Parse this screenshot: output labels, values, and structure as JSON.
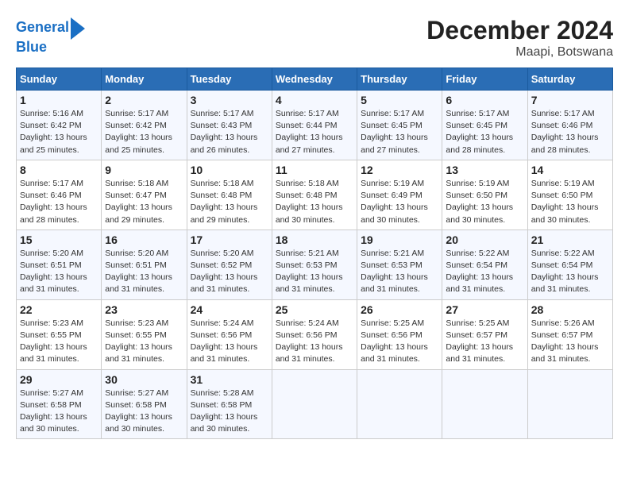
{
  "header": {
    "logo_line1": "General",
    "logo_line2": "Blue",
    "title": "December 2024",
    "subtitle": "Maapi, Botswana"
  },
  "columns": [
    "Sunday",
    "Monday",
    "Tuesday",
    "Wednesday",
    "Thursday",
    "Friday",
    "Saturday"
  ],
  "weeks": [
    [
      {
        "day": "1",
        "info": "Sunrise: 5:16 AM\nSunset: 6:42 PM\nDaylight: 13 hours\nand 25 minutes."
      },
      {
        "day": "2",
        "info": "Sunrise: 5:17 AM\nSunset: 6:42 PM\nDaylight: 13 hours\nand 25 minutes."
      },
      {
        "day": "3",
        "info": "Sunrise: 5:17 AM\nSunset: 6:43 PM\nDaylight: 13 hours\nand 26 minutes."
      },
      {
        "day": "4",
        "info": "Sunrise: 5:17 AM\nSunset: 6:44 PM\nDaylight: 13 hours\nand 27 minutes."
      },
      {
        "day": "5",
        "info": "Sunrise: 5:17 AM\nSunset: 6:45 PM\nDaylight: 13 hours\nand 27 minutes."
      },
      {
        "day": "6",
        "info": "Sunrise: 5:17 AM\nSunset: 6:45 PM\nDaylight: 13 hours\nand 28 minutes."
      },
      {
        "day": "7",
        "info": "Sunrise: 5:17 AM\nSunset: 6:46 PM\nDaylight: 13 hours\nand 28 minutes."
      }
    ],
    [
      {
        "day": "8",
        "info": "Sunrise: 5:17 AM\nSunset: 6:46 PM\nDaylight: 13 hours\nand 28 minutes."
      },
      {
        "day": "9",
        "info": "Sunrise: 5:18 AM\nSunset: 6:47 PM\nDaylight: 13 hours\nand 29 minutes."
      },
      {
        "day": "10",
        "info": "Sunrise: 5:18 AM\nSunset: 6:48 PM\nDaylight: 13 hours\nand 29 minutes."
      },
      {
        "day": "11",
        "info": "Sunrise: 5:18 AM\nSunset: 6:48 PM\nDaylight: 13 hours\nand 30 minutes."
      },
      {
        "day": "12",
        "info": "Sunrise: 5:19 AM\nSunset: 6:49 PM\nDaylight: 13 hours\nand 30 minutes."
      },
      {
        "day": "13",
        "info": "Sunrise: 5:19 AM\nSunset: 6:50 PM\nDaylight: 13 hours\nand 30 minutes."
      },
      {
        "day": "14",
        "info": "Sunrise: 5:19 AM\nSunset: 6:50 PM\nDaylight: 13 hours\nand 30 minutes."
      }
    ],
    [
      {
        "day": "15",
        "info": "Sunrise: 5:20 AM\nSunset: 6:51 PM\nDaylight: 13 hours\nand 31 minutes."
      },
      {
        "day": "16",
        "info": "Sunrise: 5:20 AM\nSunset: 6:51 PM\nDaylight: 13 hours\nand 31 minutes."
      },
      {
        "day": "17",
        "info": "Sunrise: 5:20 AM\nSunset: 6:52 PM\nDaylight: 13 hours\nand 31 minutes."
      },
      {
        "day": "18",
        "info": "Sunrise: 5:21 AM\nSunset: 6:53 PM\nDaylight: 13 hours\nand 31 minutes."
      },
      {
        "day": "19",
        "info": "Sunrise: 5:21 AM\nSunset: 6:53 PM\nDaylight: 13 hours\nand 31 minutes."
      },
      {
        "day": "20",
        "info": "Sunrise: 5:22 AM\nSunset: 6:54 PM\nDaylight: 13 hours\nand 31 minutes."
      },
      {
        "day": "21",
        "info": "Sunrise: 5:22 AM\nSunset: 6:54 PM\nDaylight: 13 hours\nand 31 minutes."
      }
    ],
    [
      {
        "day": "22",
        "info": "Sunrise: 5:23 AM\nSunset: 6:55 PM\nDaylight: 13 hours\nand 31 minutes."
      },
      {
        "day": "23",
        "info": "Sunrise: 5:23 AM\nSunset: 6:55 PM\nDaylight: 13 hours\nand 31 minutes."
      },
      {
        "day": "24",
        "info": "Sunrise: 5:24 AM\nSunset: 6:56 PM\nDaylight: 13 hours\nand 31 minutes."
      },
      {
        "day": "25",
        "info": "Sunrise: 5:24 AM\nSunset: 6:56 PM\nDaylight: 13 hours\nand 31 minutes."
      },
      {
        "day": "26",
        "info": "Sunrise: 5:25 AM\nSunset: 6:56 PM\nDaylight: 13 hours\nand 31 minutes."
      },
      {
        "day": "27",
        "info": "Sunrise: 5:25 AM\nSunset: 6:57 PM\nDaylight: 13 hours\nand 31 minutes."
      },
      {
        "day": "28",
        "info": "Sunrise: 5:26 AM\nSunset: 6:57 PM\nDaylight: 13 hours\nand 31 minutes."
      }
    ],
    [
      {
        "day": "29",
        "info": "Sunrise: 5:27 AM\nSunset: 6:58 PM\nDaylight: 13 hours\nand 30 minutes."
      },
      {
        "day": "30",
        "info": "Sunrise: 5:27 AM\nSunset: 6:58 PM\nDaylight: 13 hours\nand 30 minutes."
      },
      {
        "day": "31",
        "info": "Sunrise: 5:28 AM\nSunset: 6:58 PM\nDaylight: 13 hours\nand 30 minutes."
      },
      {
        "day": "",
        "info": ""
      },
      {
        "day": "",
        "info": ""
      },
      {
        "day": "",
        "info": ""
      },
      {
        "day": "",
        "info": ""
      }
    ]
  ]
}
